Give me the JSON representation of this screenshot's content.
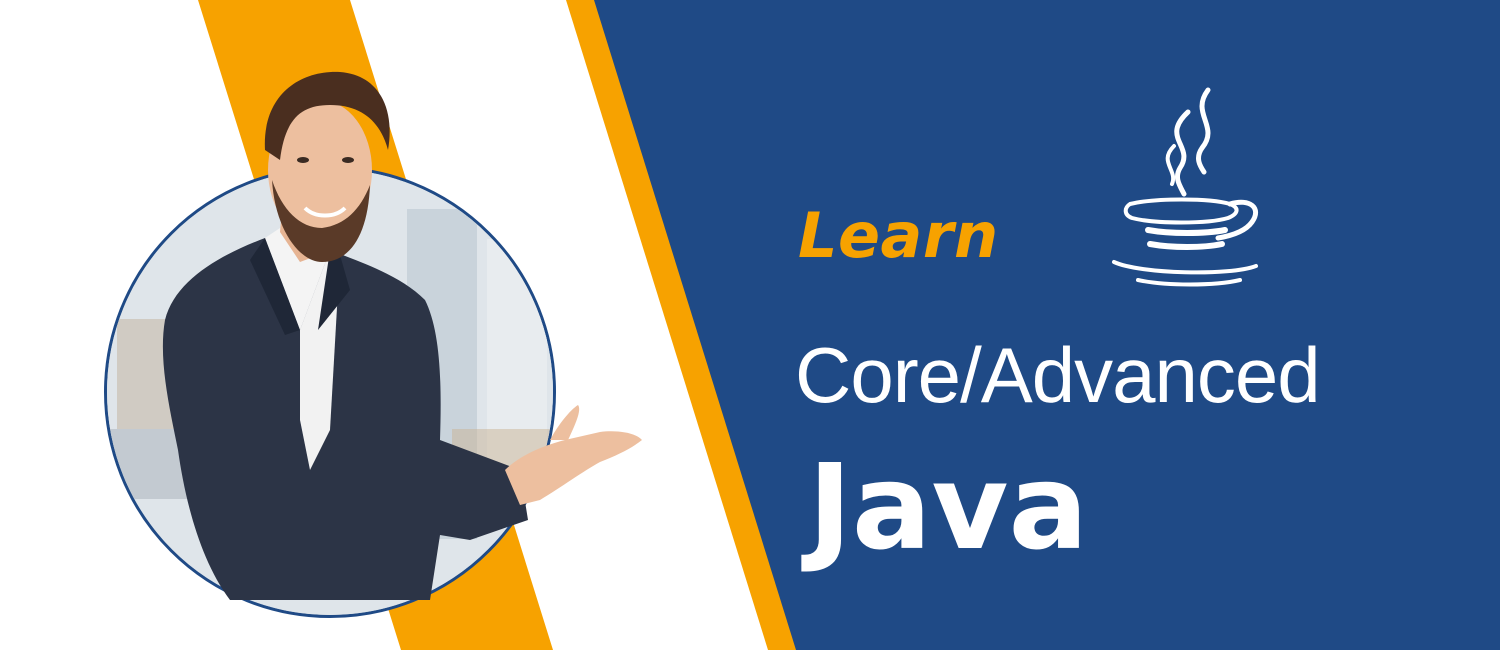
{
  "banner": {
    "learn_label": "Learn",
    "subtitle": "Core/Advanced",
    "title": "Java",
    "logo_icon": "java-coffee-cup-icon",
    "colors": {
      "accent": "#f7a200",
      "panel": "#1f4a86",
      "text": "#ffffff",
      "background": "#ffffff"
    }
  }
}
